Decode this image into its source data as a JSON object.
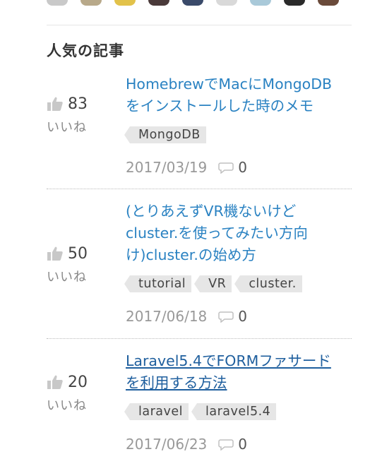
{
  "section_title": "人気の記事",
  "avatars": [
    "#c9c9c9",
    "#b8a98a",
    "#e2c24a",
    "#4a3a3a",
    "#3a4a6a",
    "#d9d9d9",
    "#a9c9d9",
    "#2a2a2a",
    "#6a4a3a"
  ],
  "articles": [
    {
      "likes": "83",
      "like_label": "いいね",
      "title_lines": [
        "HomebrewでMacにMongoDB",
        "をインストールした時のメモ"
      ],
      "tags": [
        "MongoDB"
      ],
      "date": "2017/03/19",
      "comments": "0"
    },
    {
      "likes": "50",
      "like_label": "いいね",
      "title_lines": [
        "(とりあえずVR機ないけど",
        "cluster.を使ってみたい方向",
        "け)cluster.の始め方"
      ],
      "tags": [
        "tutorial",
        "VR",
        "cluster."
      ],
      "date": "2017/06/18",
      "comments": "0"
    },
    {
      "likes": "20",
      "like_label": "いいね",
      "title_lines": [
        "Laravel5.4でFORMファサード",
        "を利用する方法"
      ],
      "tags": [
        "laravel",
        "laravel5.4"
      ],
      "date": "2017/06/23",
      "comments": "0"
    }
  ],
  "icons": {
    "thumb": "thumbs-up-icon",
    "comment": "comment-bubble-icon"
  },
  "colors": {
    "link": "#2a82c2",
    "link_hover": "#1f5f9e",
    "tag_bg": "#e6e6e6",
    "muted": "#999999"
  }
}
